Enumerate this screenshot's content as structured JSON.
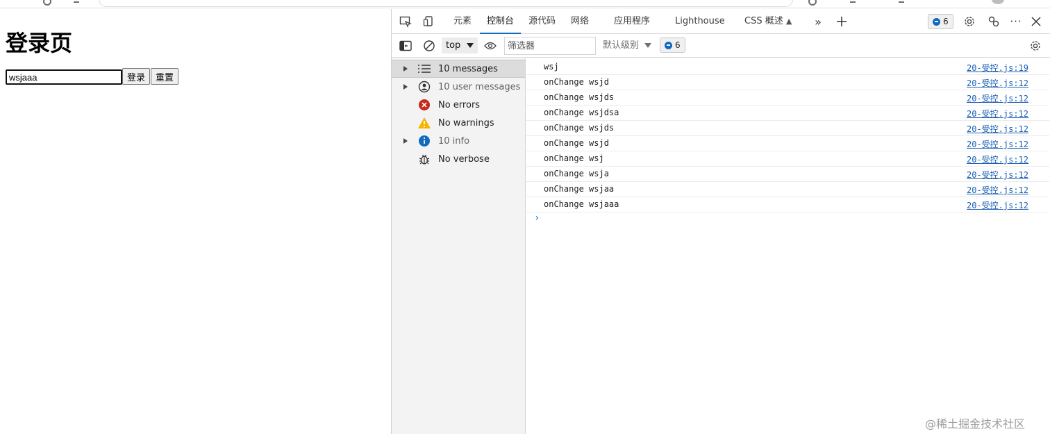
{
  "page": {
    "heading": "登录页",
    "input_value": "wsjaaa",
    "login_button": "登录",
    "reset_button": "重置"
  },
  "devtools": {
    "tabs": [
      {
        "label": "元素"
      },
      {
        "label": "控制台",
        "active": true
      },
      {
        "label": "源代码"
      },
      {
        "label": "网络"
      },
      {
        "label": "应用程序"
      },
      {
        "label": "Lighthouse"
      },
      {
        "label": "CSS 概述"
      }
    ],
    "issues_count": "6",
    "context": "top",
    "filter_placeholder": "筛选器",
    "levels": "默认级别",
    "level_badge_count": "6",
    "sidebar": [
      {
        "label": "10 messages",
        "icon": "list-icon",
        "expandable": true,
        "selected": true
      },
      {
        "label": "10 user messages",
        "icon": "user-icon",
        "expandable": true
      },
      {
        "label": "No errors",
        "icon": "error-icon"
      },
      {
        "label": "No warnings",
        "icon": "warning-icon"
      },
      {
        "label": "10 info",
        "icon": "info-icon",
        "expandable": true
      },
      {
        "label": "No verbose",
        "icon": "bug-icon"
      }
    ],
    "messages": [
      {
        "text": "wsj",
        "source": "20-受控.js:19"
      },
      {
        "text": "onChange wsjd",
        "source": "20-受控.js:12"
      },
      {
        "text": "onChange wsjds",
        "source": "20-受控.js:12"
      },
      {
        "text": "onChange wsjdsa",
        "source": "20-受控.js:12"
      },
      {
        "text": "onChange wsjds",
        "source": "20-受控.js:12"
      },
      {
        "text": "onChange wsjd",
        "source": "20-受控.js:12"
      },
      {
        "text": "onChange wsj",
        "source": "20-受控.js:12"
      },
      {
        "text": "onChange wsja",
        "source": "20-受控.js:12"
      },
      {
        "text": "onChange wsjaa",
        "source": "20-受控.js:12"
      },
      {
        "text": "onChange wsjaaa",
        "source": "20-受控.js:12"
      }
    ],
    "prompt": "›"
  },
  "watermark": "@稀土掘金技术社区",
  "colors": {
    "accent": "#0f6cbd",
    "link": "#1a5fb4",
    "error": "#c42b1c",
    "warning": "#f7b500",
    "info": "#0f6cbd"
  }
}
